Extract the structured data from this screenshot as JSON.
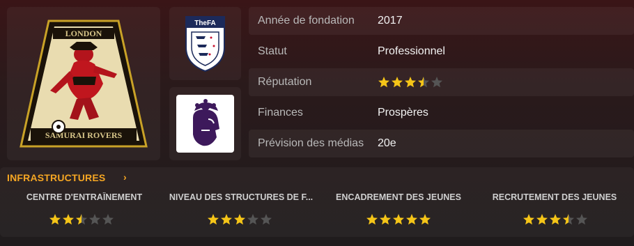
{
  "club": {
    "crest_text_top": "LONDON",
    "crest_text_bottom": "SAMURAI ROVERS"
  },
  "association_logo": {
    "text": "TheFA"
  },
  "info": {
    "rows": [
      {
        "label": "Année de fondation",
        "value": "2017"
      },
      {
        "label": "Statut",
        "value": "Professionnel"
      },
      {
        "label": "Réputation",
        "value": "",
        "stars": 3.5
      },
      {
        "label": "Finances",
        "value": "Prospères"
      },
      {
        "label": "Prévision des médias",
        "value": "20e"
      }
    ]
  },
  "infrastructures": {
    "title": "INFRASTRUCTURES",
    "items": [
      {
        "label": "CENTRE D'ENTRAÎNEMENT",
        "stars": 2.5
      },
      {
        "label": "NIVEAU DES STRUCTURES DE F...",
        "stars": 3
      },
      {
        "label": "ENCADREMENT DES JEUNES",
        "stars": 5
      },
      {
        "label": "RECRUTEMENT DES JEUNES",
        "stars": 3.5
      }
    ]
  },
  "colors": {
    "star_on": "#f5c518",
    "star_off": "#555555",
    "accent": "#f5a623"
  }
}
